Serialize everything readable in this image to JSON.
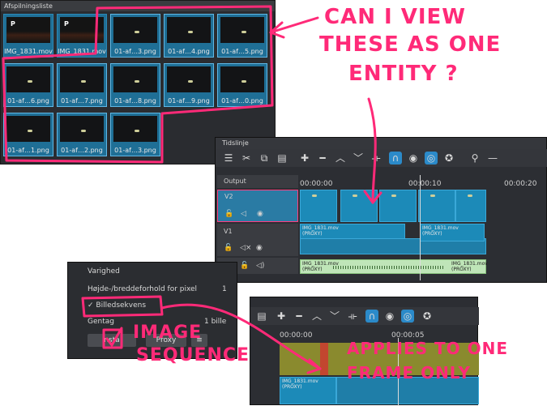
{
  "playlist": {
    "title": "Afspilningsliste",
    "items": [
      {
        "label": "IMG_1831.mov",
        "kind": "video"
      },
      {
        "label": "IMG_1831.mov",
        "kind": "video"
      },
      {
        "label": "01-af…3.png",
        "kind": "image"
      },
      {
        "label": "01-af…4.png",
        "kind": "image"
      },
      {
        "label": "01-af…5.png",
        "kind": "image"
      },
      {
        "label": "01-af…6.png",
        "kind": "image"
      },
      {
        "label": "01-af…7.png",
        "kind": "image"
      },
      {
        "label": "01-af…8.png",
        "kind": "image"
      },
      {
        "label": "01-af…9.png",
        "kind": "image"
      },
      {
        "label": "01-af…0.png",
        "kind": "image"
      },
      {
        "label": "01-af…1.png",
        "kind": "image"
      },
      {
        "label": "01-af…2.png",
        "kind": "image"
      },
      {
        "label": "01-af…3.png",
        "kind": "image"
      }
    ]
  },
  "timeline": {
    "title": "Tidslinje",
    "ruler": {
      "t0": "00:00:00",
      "t1": "00:00:10",
      "t2": "00:00:20"
    },
    "tracks": {
      "output": "Output",
      "v2": "V2",
      "v1": "V1",
      "a1": "A1"
    },
    "clips": {
      "v1a": "IMG_1831.mov\n(PROXY)",
      "v1b": "IMG_1831.mov\n(PROXY)",
      "a1a": "IMG_1831.mov\n(PROXY)",
      "a1b": "IMG_1831.mov\n(PROXY)"
    }
  },
  "properties": {
    "duration": "Varighed",
    "aspect": "Højde-/breddeforhold for pixel",
    "aspect_value": "1",
    "image_sequence_label": "Billedsekvens",
    "repeat": "Gentag",
    "repeat_value": "1 bille",
    "buttons": {
      "b1": "Instal",
      "b2": "Proxy",
      "b3": "≡"
    }
  },
  "timeline2": {
    "ruler": {
      "t0": "00:00:00",
      "t1": "00:00:05"
    },
    "clip": "IMG_1831.mov\n(PROXY)"
  },
  "annotations": {
    "question_l1": "CAN I VIEW",
    "question_l2": "THESE AS ONE",
    "question_l3": "ENTITY ?",
    "image_l1": "IMAGE",
    "image_l2": "SEQUENCE",
    "applies_l1": "APPLIES TO ONE",
    "applies_l2": "FRAME ONLY"
  },
  "colors": {
    "annotation": "#ff2a78",
    "clip": "#1c8ab8",
    "selection": "#2b8ac9"
  }
}
